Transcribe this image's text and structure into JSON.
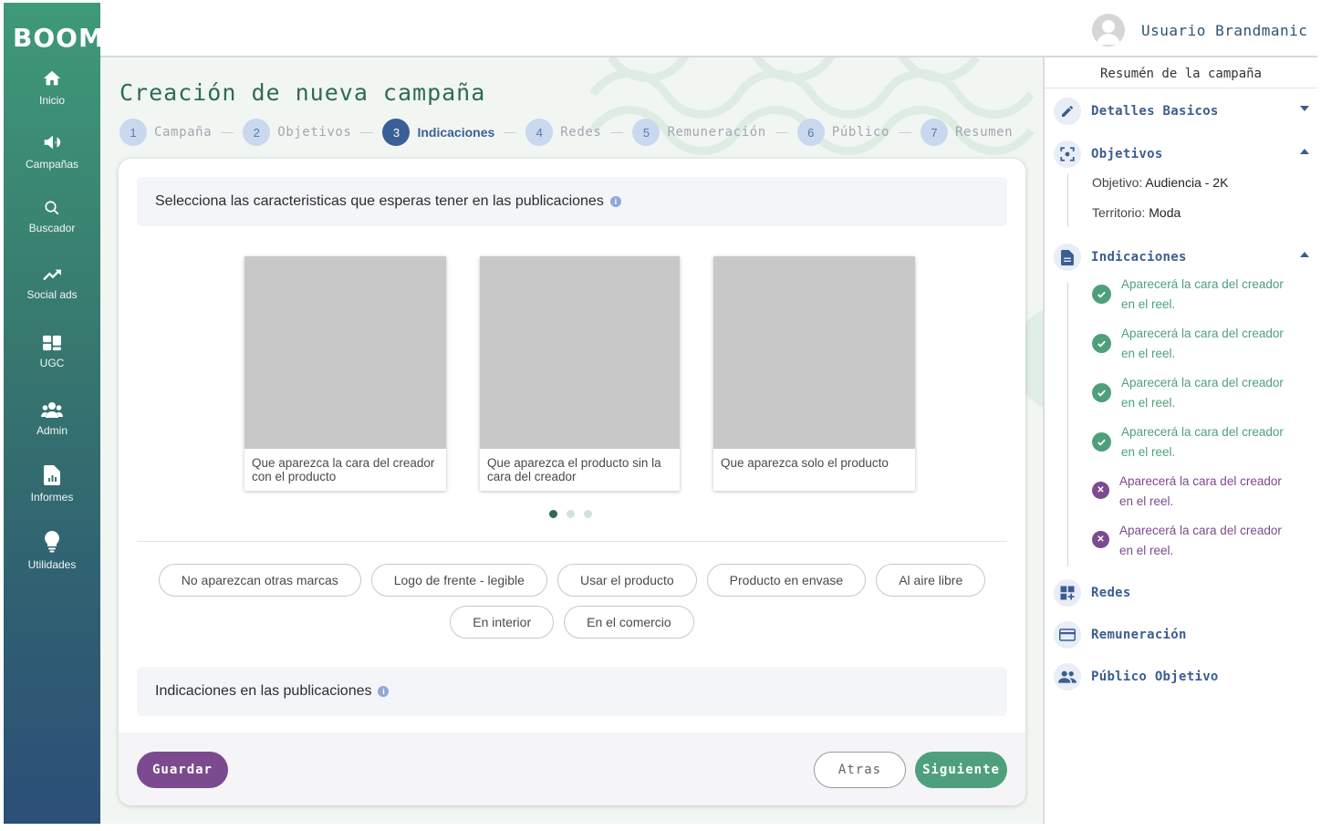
{
  "app": {
    "logo": "BOOM"
  },
  "sidebar": {
    "items": [
      {
        "label": "Inicio",
        "icon": "home-icon"
      },
      {
        "label": "Campañas",
        "icon": "megaphone-icon"
      },
      {
        "label": "Buscador",
        "icon": "search-icon"
      },
      {
        "label": "Social ads",
        "icon": "trending-up-icon"
      },
      {
        "label": "UGC",
        "icon": "dashboard-icon"
      },
      {
        "label": "Admin",
        "icon": "people-icon"
      },
      {
        "label": "Informes",
        "icon": "report-icon"
      },
      {
        "label": "Utilidades",
        "icon": "lightbulb-icon"
      }
    ]
  },
  "header": {
    "username": "Usuario Brandmanic"
  },
  "page": {
    "title": "Creación de nueva campaña",
    "steps": [
      {
        "num": "1",
        "label": "Campaña"
      },
      {
        "num": "2",
        "label": "Objetivos"
      },
      {
        "num": "3",
        "label": "Indicaciones"
      },
      {
        "num": "4",
        "label": "Redes"
      },
      {
        "num": "5",
        "label": "Remuneración"
      },
      {
        "num": "6",
        "label": "Público"
      },
      {
        "num": "7",
        "label": "Resumen"
      }
    ],
    "active_step": 3
  },
  "card": {
    "section1_title": "Selecciona las caracteristicas que esperas tener en las publicaciones",
    "images": [
      {
        "caption_line1": "Que aparezca la cara del creador",
        "caption_line2": "con el producto"
      },
      {
        "caption_line1": "Que aparezca el producto sin la",
        "caption_line2": "cara del creador"
      },
      {
        "caption_line1": "Que aparezca solo el producto",
        "caption_line2": ""
      }
    ],
    "carousel_active": 1,
    "chips": [
      "No aparezcan otras marcas",
      "Logo de frente - legible",
      "Usar el producto",
      "Producto en envase",
      "Al aire libre",
      "En interior",
      "En el comercio"
    ],
    "section2_title": "Indicaciones en las publicaciones",
    "buttons": {
      "save": "Guardar",
      "back": "Atras",
      "next": "Siguiente"
    }
  },
  "summary": {
    "title": "Resumén de la campaña",
    "sections": {
      "basics": "Detalles Basicos",
      "objectives": "Objetivos",
      "indications": "Indicaciones",
      "networks": "Redes",
      "remuneration": "Remuneración",
      "audience": "Público Objetivo"
    },
    "objective_label": "Objetivo:",
    "objective_value": "Audiencia - 2K",
    "territory_label": "Territorio:",
    "territory_value": "Moda",
    "indications": [
      {
        "line1": "Aparecerá la cara del creador",
        "line2": "en el reel.",
        "status": "ok"
      },
      {
        "line1": "Aparecerá la cara del creador",
        "line2": "en el reel.",
        "status": "ok"
      },
      {
        "line1": "Aparecerá la cara del creador",
        "line2": "en el reel.",
        "status": "ok"
      },
      {
        "line1": "Aparecerá la cara del creador",
        "line2": "en el reel.",
        "status": "ok"
      },
      {
        "line1": "Aparecerá la cara del creador",
        "line2": "en el reel.",
        "status": "no"
      },
      {
        "line1": "Aparecerá la cara del creador",
        "line2": "en el reel.",
        "status": "no"
      }
    ]
  },
  "colors": {
    "primary_green": "#4ea07c",
    "primary_purple": "#7c4a8e",
    "step_active": "#3a5f96",
    "title_green": "#2f6b56"
  }
}
